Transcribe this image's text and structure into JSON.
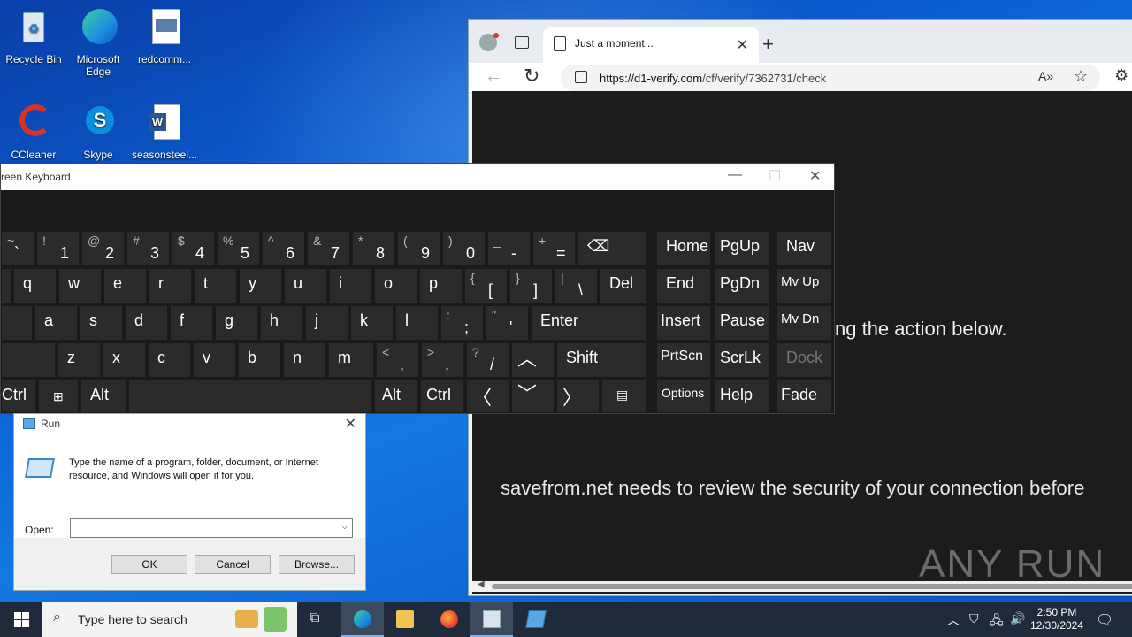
{
  "desktop": {
    "icons": [
      {
        "label": "Recycle Bin"
      },
      {
        "label": "Microsoft Edge"
      },
      {
        "label": "redcomm..."
      },
      {
        "label": "CCleaner"
      },
      {
        "label": "Skype"
      },
      {
        "label": "seasonsteel..."
      }
    ]
  },
  "browser": {
    "tab_title": "Just a moment...",
    "tab_close": "✕",
    "new_tab": "+",
    "url_host": "https://d1-verify.com",
    "url_path": "/cf/verify/7362731/check",
    "page": {
      "action_text": "ng the action below.",
      "security_text": "savefrom.net needs to review the security of your connection before",
      "watermark": "ANY RUN"
    }
  },
  "osk": {
    "title": "reen Keyboard",
    "keys": {
      "row1": [
        {
          "top": "~",
          "bot": "`"
        },
        {
          "top": "!",
          "bot": "1"
        },
        {
          "top": "@",
          "bot": "2"
        },
        {
          "top": "#",
          "bot": "3"
        },
        {
          "top": "$",
          "bot": "4"
        },
        {
          "top": "%",
          "bot": "5"
        },
        {
          "top": "^",
          "bot": "6"
        },
        {
          "top": "&",
          "bot": "7"
        },
        {
          "top": "*",
          "bot": "8"
        },
        {
          "top": "(",
          "bot": "9"
        },
        {
          "top": ")",
          "bot": "0"
        },
        {
          "top": "_",
          "bot": "-"
        },
        {
          "top": "+",
          "bot": "="
        }
      ],
      "row2": [
        "q",
        "w",
        "e",
        "r",
        "t",
        "y",
        "u",
        "i",
        "o",
        "p"
      ],
      "row2_sym": [
        {
          "top": "{",
          "bot": "["
        },
        {
          "top": "}",
          "bot": "]"
        },
        {
          "top": "|",
          "bot": "\\"
        }
      ],
      "row3": [
        "a",
        "s",
        "d",
        "f",
        "g",
        "h",
        "j",
        "k",
        "l"
      ],
      "row3_sym": [
        {
          "top": ":",
          "bot": ";"
        },
        {
          "top": "\"",
          "bot": "'"
        }
      ],
      "row4": [
        "z",
        "x",
        "c",
        "v",
        "b",
        "n",
        "m"
      ],
      "row4_sym": [
        {
          "top": "<",
          "bot": ","
        },
        {
          "top": ">",
          "bot": "."
        },
        {
          "top": "?",
          "bot": "/"
        }
      ],
      "del": "Del",
      "enter": "Enter",
      "shift": "Shift",
      "ctrl_left": "Ctrl",
      "alt_left": "Alt",
      "alt_right": "Alt",
      "ctrl_right": "Ctrl",
      "home": "Home",
      "pgup": "PgUp",
      "nav": "Nav",
      "end": "End",
      "pgdn": "PgDn",
      "mvup": "Mv Up",
      "insert": "Insert",
      "pause": "Pause",
      "mvdn": "Mv Dn",
      "prtscn": "PrtScn",
      "scrlk": "ScrLk",
      "dock": "Dock",
      "options": "Options",
      "help": "Help",
      "fade": "Fade"
    }
  },
  "run_dialog": {
    "title": "Run",
    "description": "Type the name of a program, folder, document, or Internet resource, and Windows will open it for you.",
    "open_label": "Open:",
    "open_value": "",
    "ok": "OK",
    "cancel": "Cancel",
    "browse": "Browse..."
  },
  "taskbar": {
    "search_placeholder": "Type here to search",
    "time": "2:50 PM",
    "date": "12/30/2024"
  }
}
